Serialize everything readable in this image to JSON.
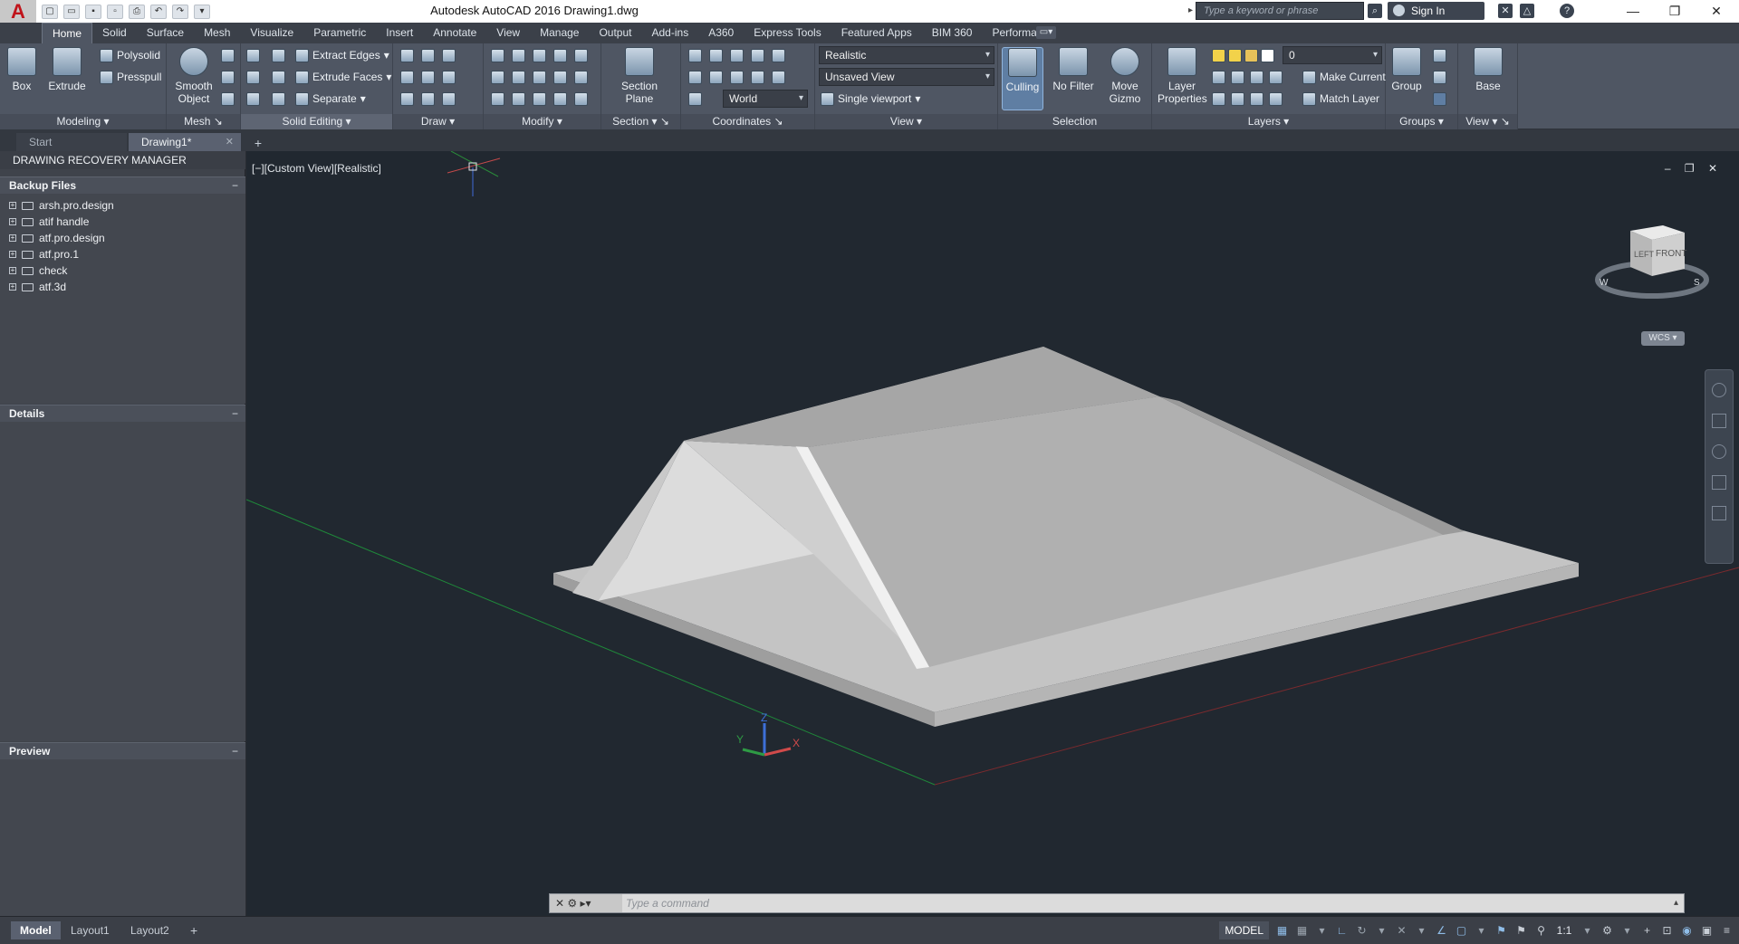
{
  "app": {
    "logo": "A",
    "title": "Autodesk AutoCAD 2016    Drawing1.dwg"
  },
  "search": {
    "placeholder": "Type a keyword or phrase"
  },
  "account": {
    "signin": "Sign In"
  },
  "menu_tabs": [
    "Home",
    "Solid",
    "Surface",
    "Mesh",
    "Visualize",
    "Parametric",
    "Insert",
    "Annotate",
    "View",
    "Manage",
    "Output",
    "Add-ins",
    "A360",
    "Express Tools",
    "Featured Apps",
    "BIM 360",
    "Performance"
  ],
  "ribbon": {
    "modeling": {
      "label": "Modeling",
      "box": "Box",
      "extrude": "Extrude",
      "polysolid": "Polysolid",
      "presspull": "Presspull"
    },
    "mesh": {
      "label": "Mesh",
      "smooth_object": "Smooth Object"
    },
    "solid_editing": {
      "label": "Solid Editing",
      "extract_edges": "Extract Edges",
      "extrude_faces": "Extrude Faces",
      "separate": "Separate"
    },
    "draw": {
      "label": "Draw"
    },
    "modify": {
      "label": "Modify"
    },
    "section": {
      "label": "Section",
      "section_plane": "Section Plane"
    },
    "coordinates": {
      "label": "Coordinates",
      "ucs": "World"
    },
    "view": {
      "label": "View",
      "visual_style": "Realistic",
      "named_view": "Unsaved View",
      "viewport_config": "Single viewport"
    },
    "selection": {
      "label": "Selection",
      "culling": "Culling",
      "no_filter": "No Filter",
      "move_gizmo": "Move Gizmo"
    },
    "layers": {
      "label": "Layers",
      "layer_properties": "Layer Properties",
      "current_layer": "0",
      "make_current": "Make Current",
      "match_layer": "Match Layer"
    },
    "groups": {
      "label": "Groups",
      "group": "Group"
    },
    "view2": {
      "label": "View",
      "base": "Base"
    }
  },
  "doc_tabs": {
    "start": "Start",
    "drawing": "Drawing1*"
  },
  "recovery": {
    "title": "DRAWING RECOVERY MANAGER",
    "backup_header": "Backup Files",
    "files": [
      "arsh.pro.design",
      "atif handle",
      "atf.pro.design",
      "atf.pro.1",
      "check",
      "atf.3d"
    ],
    "details_header": "Details",
    "preview_header": "Preview"
  },
  "viewport": {
    "label": "[−][Custom View][Realistic]",
    "viewcube_left": "LEFT",
    "viewcube_front": "FRONT",
    "viewcube_w": "W",
    "viewcube_s": "S",
    "wcs": "WCS ▾",
    "axis_x": "X",
    "axis_y": "Y",
    "axis_z": "Z"
  },
  "command": {
    "placeholder": "Type a command"
  },
  "layout_tabs": [
    "Model",
    "Layout1",
    "Layout2"
  ],
  "status": {
    "model": "MODEL",
    "scale": "1:1"
  }
}
